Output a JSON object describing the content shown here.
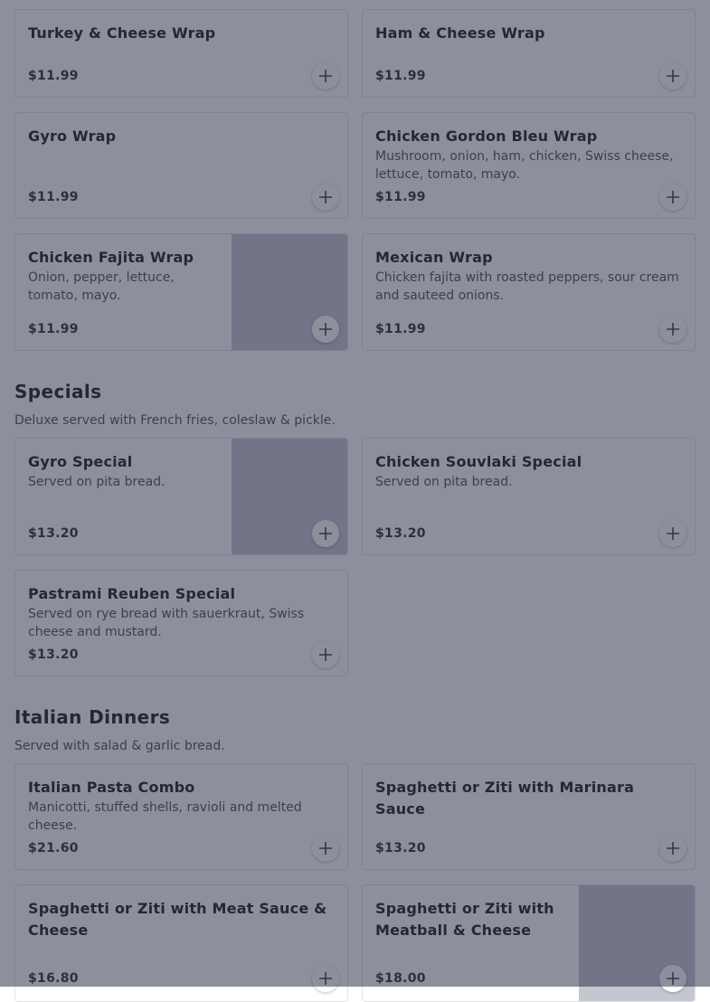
{
  "wraps": [
    {
      "name": "Turkey & Cheese Wrap",
      "desc": "",
      "price": "$11.99"
    },
    {
      "name": "Ham & Cheese Wrap",
      "desc": "",
      "price": "$11.99"
    },
    {
      "name": "Gyro Wrap",
      "desc": "",
      "price": "$11.99"
    },
    {
      "name": "Chicken Gordon Bleu Wrap",
      "desc": "Mushroom, onion, ham, chicken, Swiss cheese, lettuce, tomato, mayo.",
      "price": "$11.99"
    },
    {
      "name": "Chicken Fajita Wrap",
      "desc": "Onion, pepper, lettuce, tomato, mayo.",
      "price": "$11.99"
    },
    {
      "name": "Mexican Wrap",
      "desc": "Chicken fajita with roasted peppers, sour cream and sauteed onions.",
      "price": "$11.99"
    }
  ],
  "specials": {
    "title": "Specials",
    "subtitle": "Deluxe served with French fries, coleslaw & pickle.",
    "items": [
      {
        "name": "Gyro Special",
        "desc": "Served on pita bread.",
        "price": "$13.20"
      },
      {
        "name": "Chicken Souvlaki Special",
        "desc": "Served on pita bread.",
        "price": "$13.20"
      },
      {
        "name": "Pastrami Reuben Special",
        "desc": "Served on rye bread with sauerkraut, Swiss cheese and mustard.",
        "price": "$13.20"
      }
    ]
  },
  "italian": {
    "title": "Italian Dinners",
    "subtitle": "Served with salad & garlic bread.",
    "items": [
      {
        "name": "Italian Pasta Combo",
        "desc": "Manicotti, stuffed shells, ravioli and melted cheese.",
        "price": "$21.60"
      },
      {
        "name": "Spaghetti or Ziti with Marinara Sauce",
        "desc": "",
        "price": "$13.20"
      },
      {
        "name": "Spaghetti or Ziti with Meat Sauce & Cheese",
        "desc": "",
        "price": "$16.80"
      },
      {
        "name": "Spaghetti or Ziti with Meatball & Cheese",
        "desc": "",
        "price": "$18.00"
      }
    ]
  },
  "icons": {
    "add": "plus-icon"
  },
  "colors": {
    "overlay": "#282c46",
    "price": "#333333",
    "thumb": "#c4c7d0"
  }
}
